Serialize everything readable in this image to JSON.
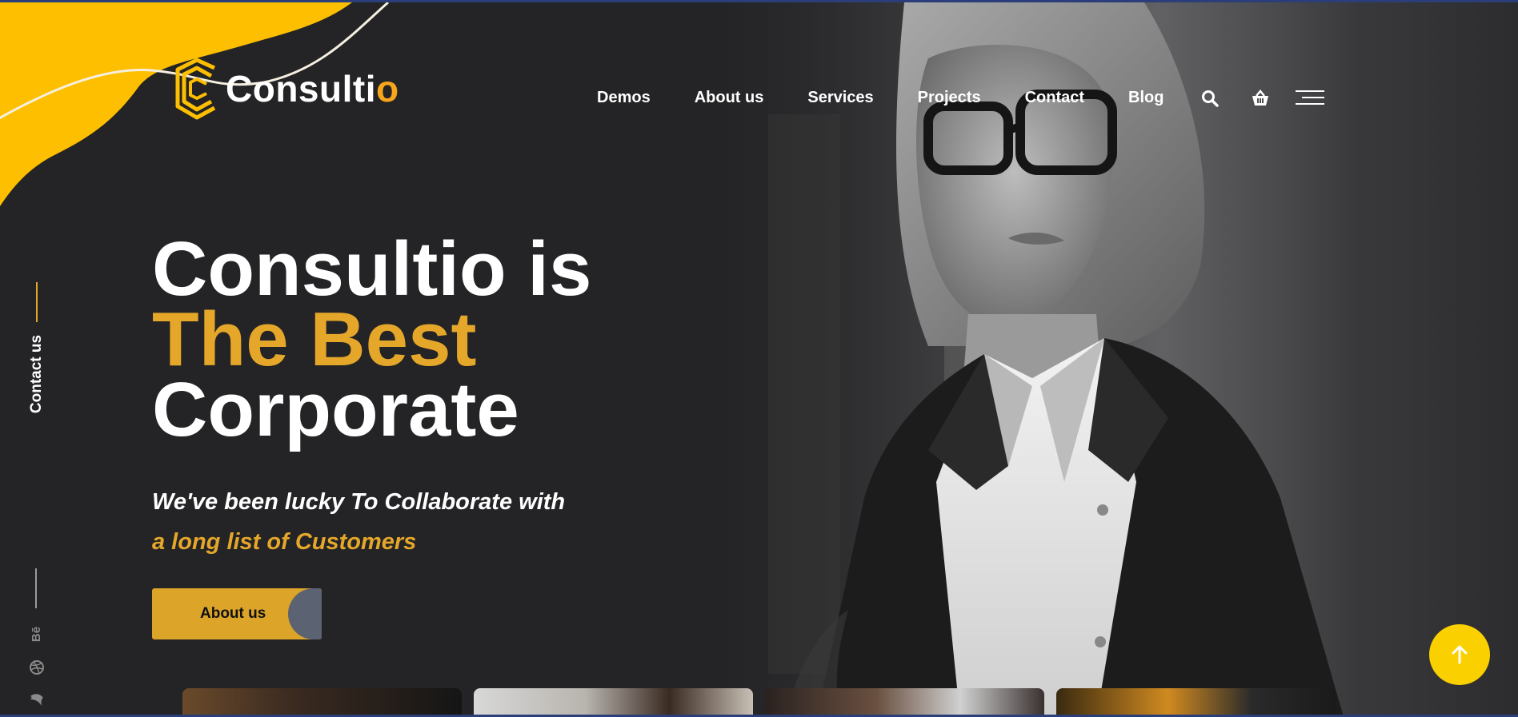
{
  "brand": {
    "name_main": "Consulti",
    "name_accent": "o",
    "accent_color": "#f7a51a",
    "blob_color": "#fdbf00"
  },
  "nav": {
    "items": [
      "Demos",
      "About us",
      "Services",
      "Projects",
      "Contact",
      "Blog"
    ],
    "icons": [
      "search-icon",
      "cart-icon",
      "hamburger-menu-icon"
    ]
  },
  "hero": {
    "title_line1": "Consultio is",
    "title_line2": "The Best",
    "title_line3": "Corporate",
    "subtitle_line1": "We've been lucky To Collaborate with",
    "subtitle_line2": "a long list of Customers",
    "cta_label": "About us",
    "accent_color": "#e5a72a"
  },
  "side_rail": {
    "contact_label": "Contact us",
    "social_icons": [
      "behance-icon",
      "dribbble-icon",
      "social-bird-icon"
    ],
    "behance_text": "Bē"
  },
  "scroll_top": {
    "icon": "arrow-up-icon",
    "color": "#fbd000"
  },
  "cards": {
    "count": 4
  }
}
